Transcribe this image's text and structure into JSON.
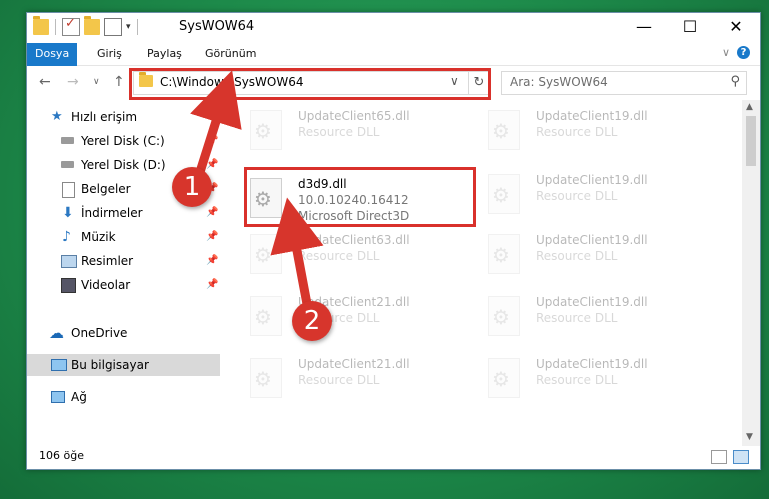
{
  "window": {
    "title": "SysWOW64",
    "controls": {
      "minimize": "—",
      "maximize": "☐",
      "close": "✕"
    }
  },
  "ribbon": {
    "tabs": [
      "Dosya",
      "Giriş",
      "Paylaş",
      "Görünüm"
    ],
    "help": "?"
  },
  "address": {
    "path": "C:\\Windows\\SysWOW64",
    "search_placeholder": "Ara: SysWOW64"
  },
  "sidebar": {
    "items": [
      {
        "label": "Hızlı erişim",
        "icon": "star-icon"
      },
      {
        "label": "Yerel Disk (C:)",
        "icon": "drive-icon",
        "pinned": true
      },
      {
        "label": "Yerel Disk (D:)",
        "icon": "drive-icon",
        "pinned": true
      },
      {
        "label": "Belgeler",
        "icon": "documents-icon",
        "pinned": true
      },
      {
        "label": "İndirmeler",
        "icon": "downloads-icon",
        "pinned": true
      },
      {
        "label": "Müzik",
        "icon": "music-icon",
        "pinned": true
      },
      {
        "label": "Resimler",
        "icon": "pictures-icon",
        "pinned": true
      },
      {
        "label": "Videolar",
        "icon": "videos-icon",
        "pinned": true
      },
      {
        "label": "OneDrive",
        "icon": "cloud-icon"
      },
      {
        "label": "Bu bilgisayar",
        "icon": "computer-icon",
        "selected": true
      },
      {
        "label": "Ağ",
        "icon": "network-icon"
      }
    ]
  },
  "files": {
    "left": [
      {
        "name": "UpdateClient65.dll",
        "type": "Resource DLL"
      },
      {
        "name": "d3d9.dll",
        "version": "10.0.10240.16412",
        "type": "Microsoft Direct3D"
      },
      {
        "name": "UpdateClient63.dll",
        "type": "Resource DLL"
      },
      {
        "name": "UpdateClient21.dll",
        "type": "Resource DLL"
      },
      {
        "name": "UpdateClient21.dll",
        "type": "Resource DLL"
      }
    ],
    "right": [
      {
        "name": "UpdateClient19.dll",
        "type": "Resource DLL"
      },
      {
        "name": "UpdateClient19.dll",
        "type": "Resource DLL"
      },
      {
        "name": "UpdateClient19.dll",
        "type": "Resource DLL"
      },
      {
        "name": "UpdateClient19.dll",
        "type": "Resource DLL"
      },
      {
        "name": "UpdateClient19.dll",
        "type": "Resource DLL"
      }
    ]
  },
  "status": {
    "count": "106 öğe"
  },
  "annotations": {
    "step1": "1",
    "step2": "2",
    "color": "#d7352c"
  }
}
